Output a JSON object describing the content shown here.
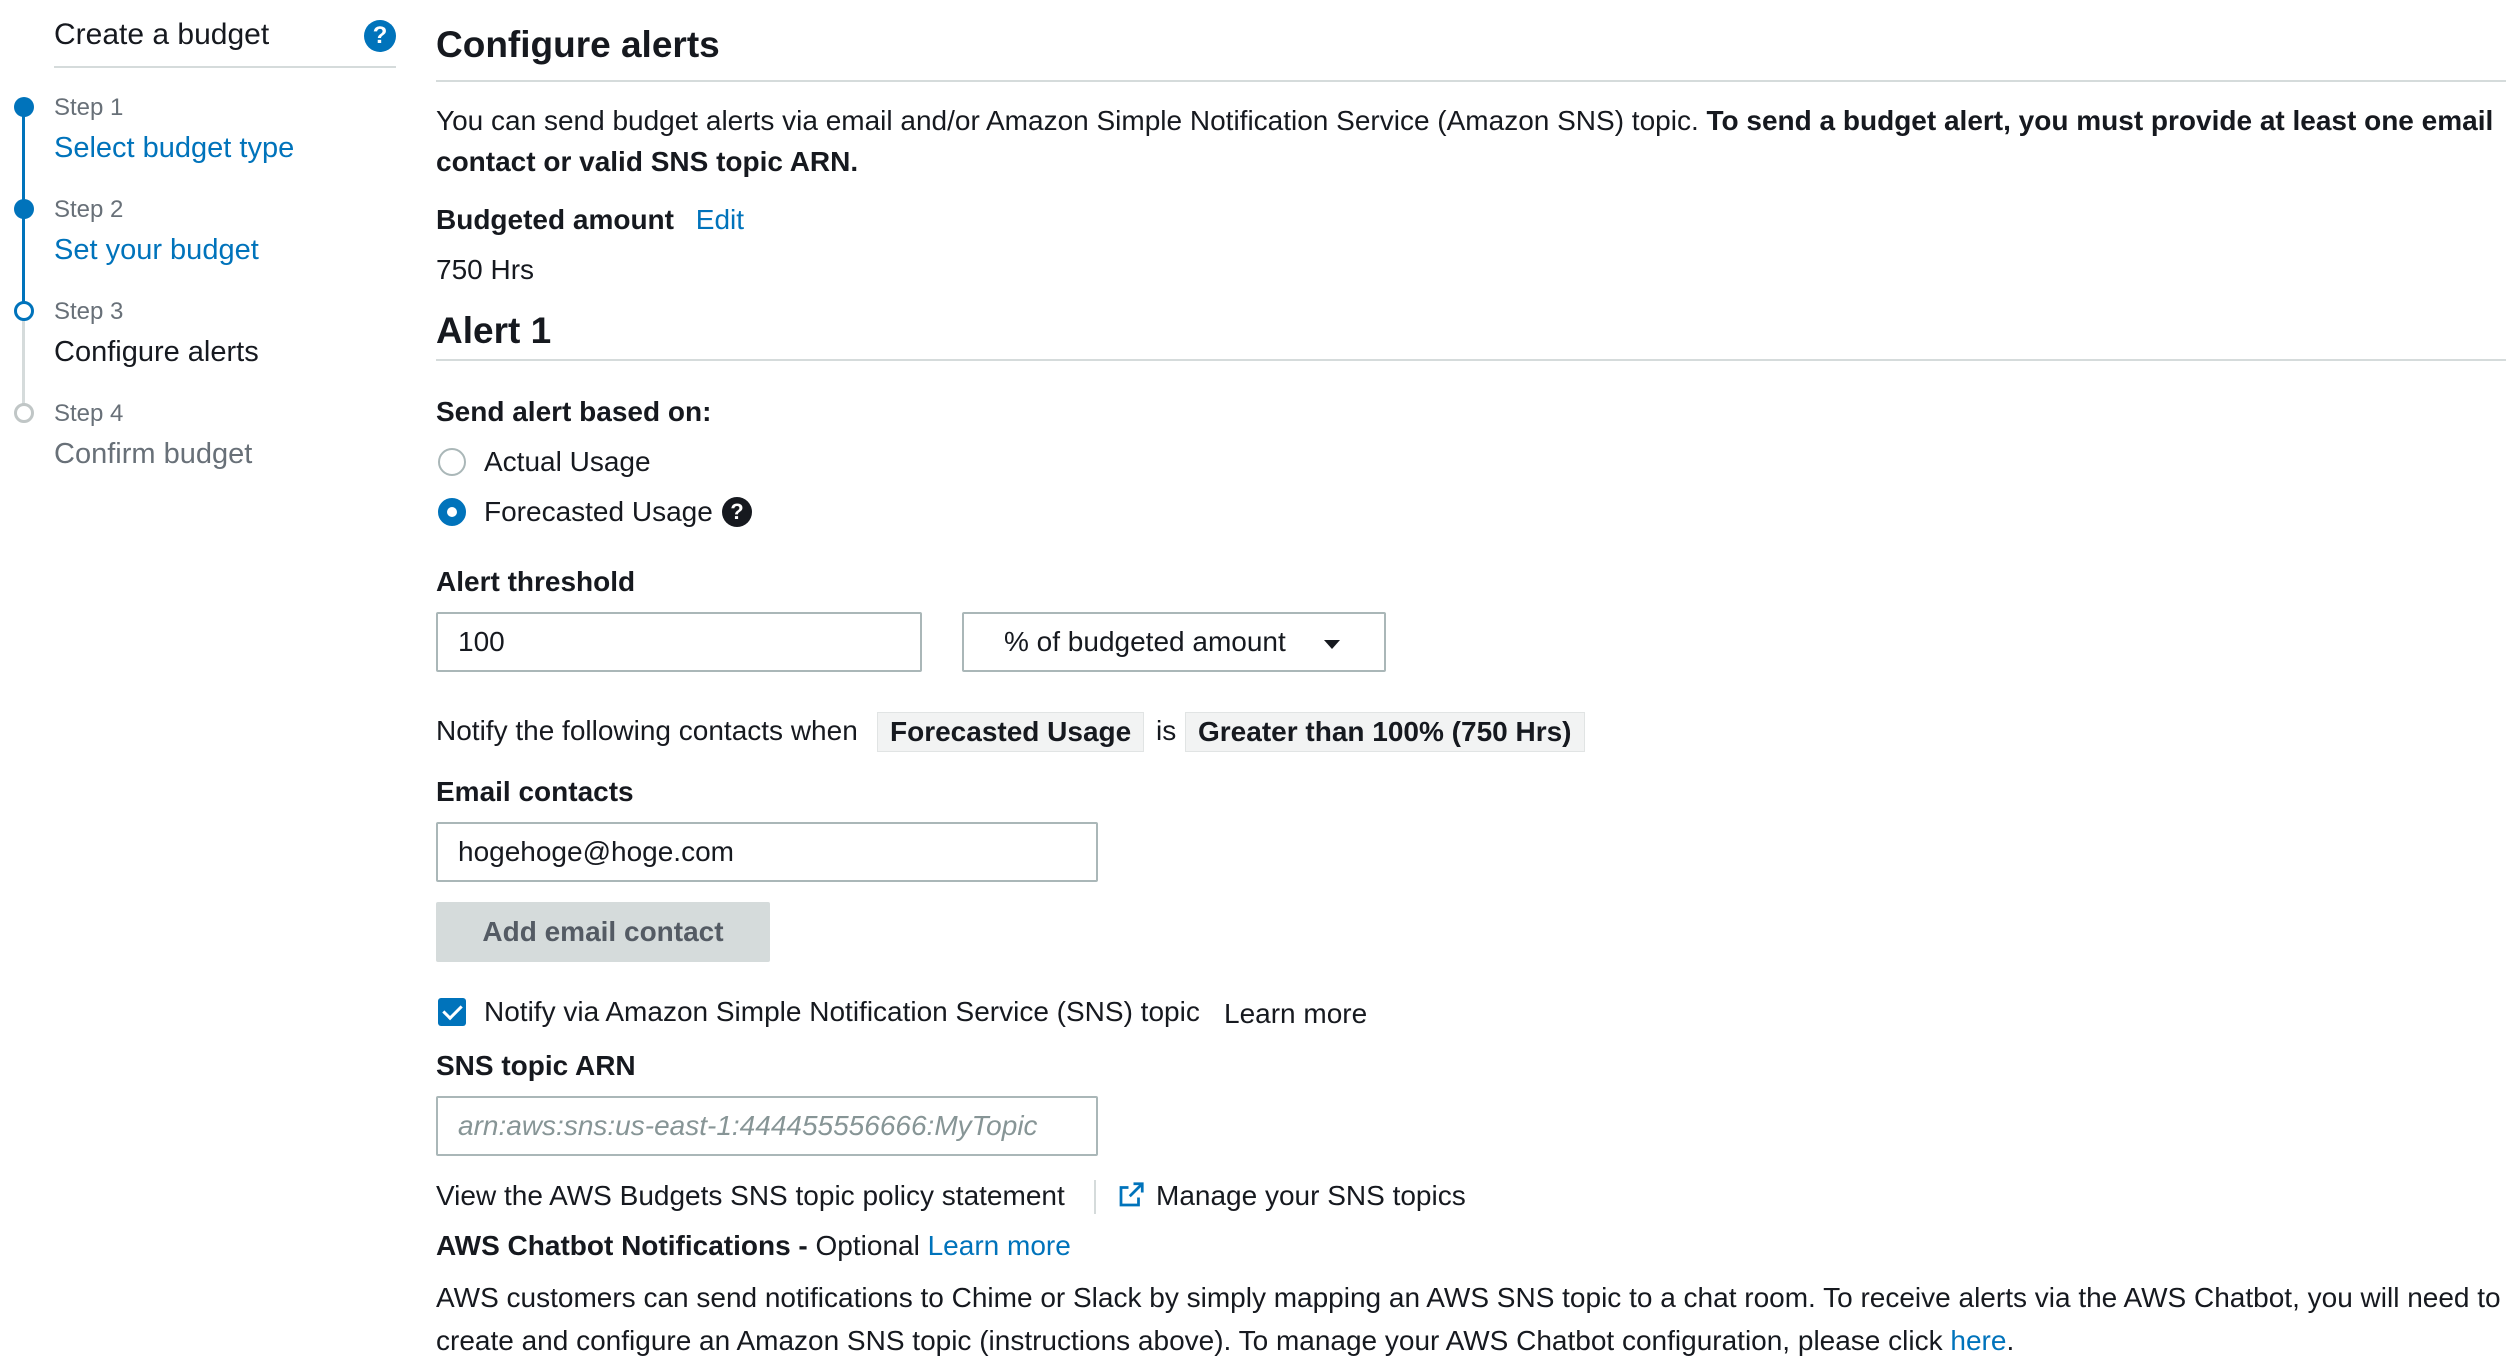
{
  "sidebar": {
    "title": "Create a budget",
    "help_icon": "help-circle-icon",
    "steps": [
      {
        "num": "Step 1",
        "label": "Select budget type",
        "state": "done"
      },
      {
        "num": "Step 2",
        "label": "Set your budget",
        "state": "done"
      },
      {
        "num": "Step 3",
        "label": "Configure alerts",
        "state": "current"
      },
      {
        "num": "Step 4",
        "label": "Confirm budget",
        "state": "todo"
      }
    ]
  },
  "main": {
    "title": "Configure alerts",
    "intro_text": "You can send budget alerts via email and/or Amazon Simple Notification Service (Amazon SNS) topic. ",
    "intro_bold": "To send a budget alert, you must provide at least one email contact or valid SNS topic ARN.",
    "budgeted_amount_label": "Budgeted amount",
    "edit_link": "Edit",
    "budgeted_amount_value": "750 Hrs",
    "alert_title": "Alert 1",
    "send_based_on_label": "Send alert based on:",
    "radio_options": [
      {
        "label": "Actual Usage",
        "checked": false
      },
      {
        "label": "Forecasted Usage",
        "checked": true
      }
    ],
    "threshold_label": "Alert threshold",
    "threshold_value": "100",
    "threshold_unit": "% of budgeted amount",
    "notify_prefix": "Notify the following contacts when",
    "notify_chip_1": "Forecasted Usage",
    "notify_is": "is",
    "notify_chip_2": "Greater than 100% (750 Hrs)",
    "email_label": "Email contacts",
    "email_value": "hogehoge@hoge.com",
    "add_email_button": "Add email contact",
    "sns_checkbox_label": "Notify via Amazon Simple Notification Service (SNS) topic",
    "sns_checked": true,
    "learn_more_1": "Learn more",
    "sns_arn_label": "SNS topic ARN",
    "sns_arn_placeholder": "arn:aws:sns:us-east-1:444455556666:MyTopic",
    "policy_link": "View the AWS Budgets SNS topic policy statement",
    "manage_sns_link": "Manage your SNS topics",
    "chatbot_label": "AWS Chatbot Notifications - ",
    "chatbot_optional": "Optional",
    "learn_more_2": "Learn more",
    "chatbot_text": "AWS customers can send notifications to Chime or Slack by simply mapping an AWS SNS topic to a chat room. To receive alerts via the AWS Chatbot, you will need to create and configure an Amazon SNS topic (instructions above). To manage your AWS Chatbot configuration, please click ",
    "here_link": "here",
    "period": "."
  },
  "colors": {
    "accent": "#0073bb",
    "text": "#16191f",
    "muted": "#687078",
    "border": "#d5dbdb"
  }
}
